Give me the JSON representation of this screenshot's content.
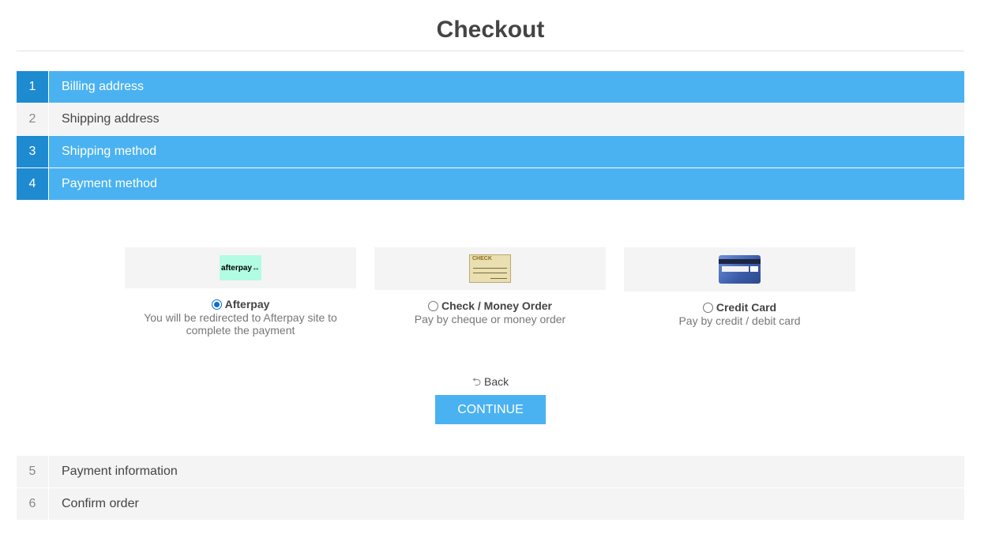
{
  "page": {
    "title": "Checkout"
  },
  "steps": [
    {
      "number": "1",
      "label": "Billing address",
      "state": "active"
    },
    {
      "number": "2",
      "label": "Shipping address",
      "state": "inactive"
    },
    {
      "number": "3",
      "label": "Shipping method",
      "state": "active"
    },
    {
      "number": "4",
      "label": "Payment method",
      "state": "active"
    },
    {
      "number": "5",
      "label": "Payment information",
      "state": "inactive"
    },
    {
      "number": "6",
      "label": "Confirm order",
      "state": "inactive"
    }
  ],
  "payment_methods": [
    {
      "name": "Afterpay",
      "description": "You will be redirected to Afterpay site to complete the payment",
      "logo_text": "afterpay↔",
      "selected": true
    },
    {
      "name": "Check / Money Order",
      "description": "Pay by cheque or money order",
      "logo_text": "CHECK",
      "selected": false
    },
    {
      "name": "Credit Card",
      "description": "Pay by credit / debit card",
      "logo_text": "",
      "selected": false
    }
  ],
  "actions": {
    "back_label": "Back",
    "continue_label": "CONTINUE",
    "back_icon": "undo-arrow-icon"
  },
  "colors": {
    "accent": "#4ab2f1",
    "accent_dark": "#1e8bd1",
    "inactive_bg": "#f4f4f4"
  }
}
